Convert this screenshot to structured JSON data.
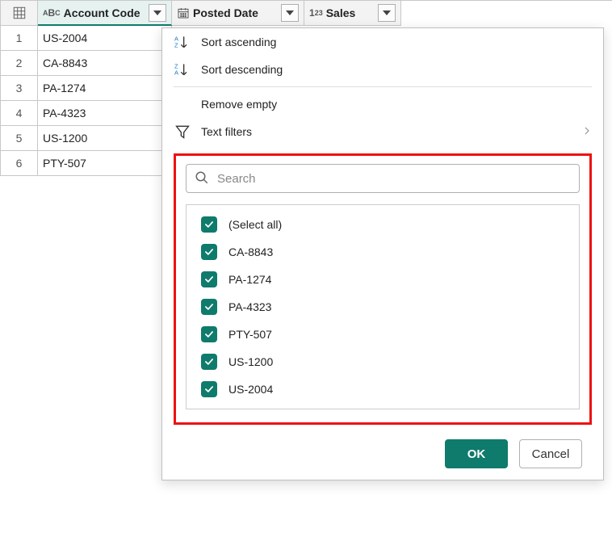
{
  "columns": {
    "account_code": "Account Code",
    "posted_date": "Posted Date",
    "sales": "Sales"
  },
  "rows": [
    {
      "n": "1",
      "code": "US-2004"
    },
    {
      "n": "2",
      "code": "CA-8843"
    },
    {
      "n": "3",
      "code": "PA-1274"
    },
    {
      "n": "4",
      "code": "PA-4323"
    },
    {
      "n": "5",
      "code": "US-1200"
    },
    {
      "n": "6",
      "code": "PTY-507"
    }
  ],
  "menu": {
    "sort_asc": "Sort ascending",
    "sort_desc": "Sort descending",
    "remove_empty": "Remove empty",
    "text_filters": "Text filters"
  },
  "search": {
    "placeholder": "Search"
  },
  "filter_values": [
    "(Select all)",
    "CA-8843",
    "PA-1274",
    "PA-4323",
    "PTY-507",
    "US-1200",
    "US-2004"
  ],
  "buttons": {
    "ok": "OK",
    "cancel": "Cancel"
  },
  "colors": {
    "accent": "#0f7b6c",
    "highlight_border": "#e11"
  }
}
